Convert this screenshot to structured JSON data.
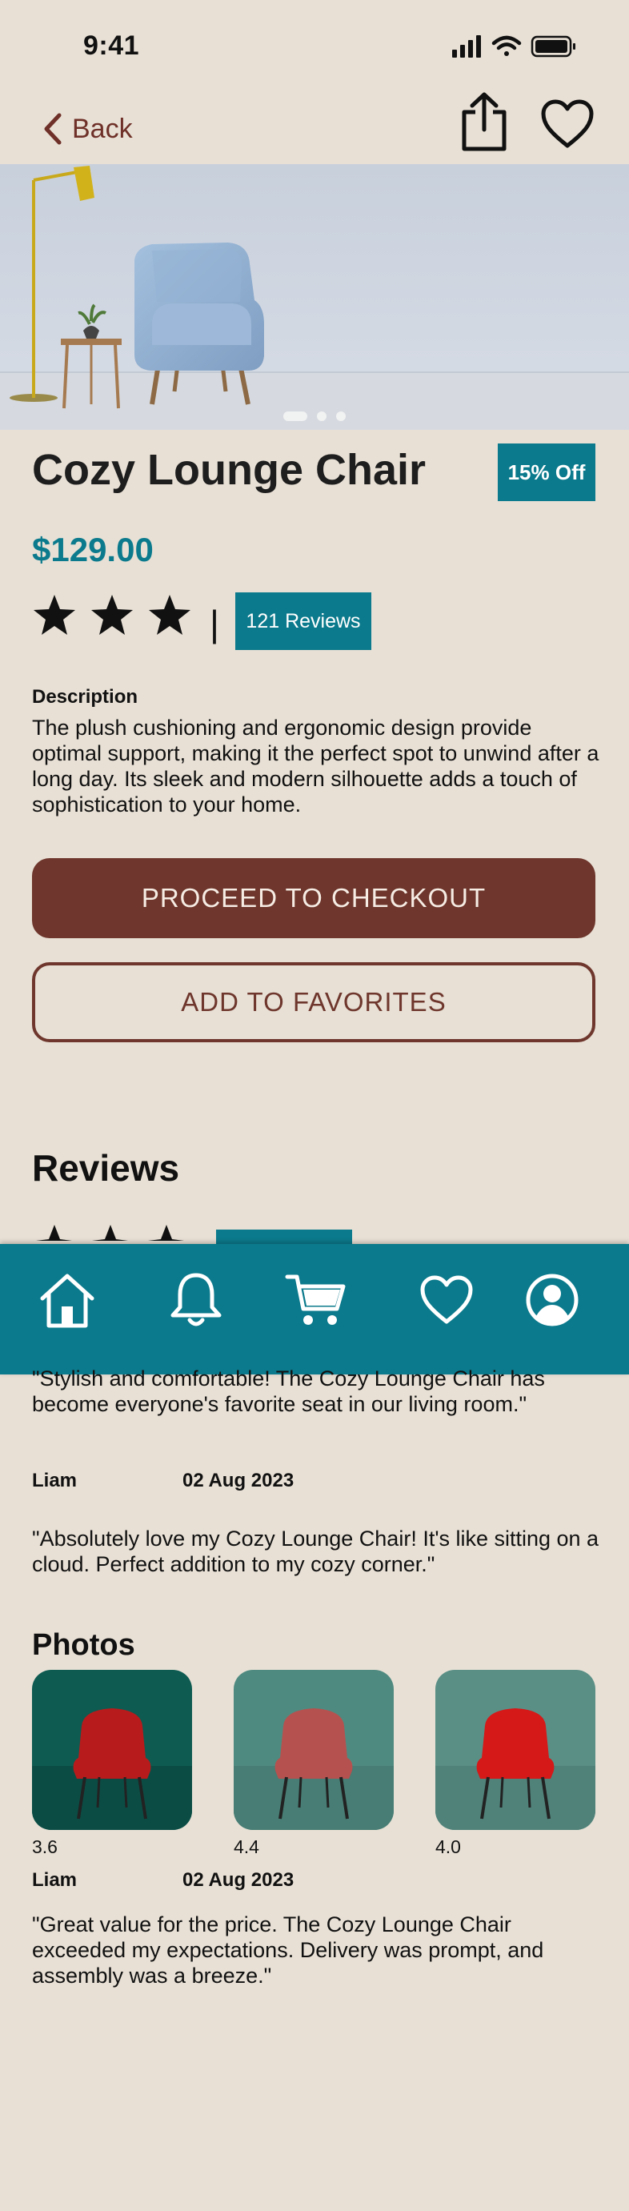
{
  "status": {
    "time": "9:41"
  },
  "nav": {
    "back_label": "Back"
  },
  "product": {
    "title": "Cozy Lounge Chair",
    "discount": "15% Off",
    "price": "$129.00",
    "rating_stars": 3,
    "reviews_count_label": "121 Reviews",
    "description_label": "Description",
    "description": "The plush cushioning and ergonomic design provide optimal support, making it the perfect spot to unwind after a long day. Its sleek and modern silhouette adds a touch of sophistication to your home."
  },
  "actions": {
    "checkout_label": "PROCEED TO CHECKOUT",
    "add_favorites_label": "ADD TO FAVORITES"
  },
  "reviews": {
    "heading": "Reviews",
    "items": [
      {
        "text": "\"Stylish and comfortable! The Cozy Lounge Chair has become everyone's favorite seat in our living room.\"",
        "name": "Liam",
        "date": "02 Aug 2023"
      },
      {
        "text": "\"Absolutely love my Cozy Lounge Chair! It's like sitting on a cloud. Perfect addition to my cozy corner.\"",
        "name": "Liam",
        "date": "02 Aug 2023"
      },
      {
        "text": " \"Great value for the price. The Cozy Lounge Chair exceeded my expectations. Delivery was prompt, and assembly was a breeze.\""
      }
    ]
  },
  "photos": {
    "heading": "Photos",
    "items": [
      {
        "rating": "3.6",
        "bg": "#0e5b52",
        "chair": "#b81b1b"
      },
      {
        "rating": "4.4",
        "bg": "#4f8a80",
        "chair": "#b5524f"
      },
      {
        "rating": "4.0",
        "bg": "#5a8f86",
        "chair": "#d51818"
      }
    ]
  },
  "tabbar": {
    "items": [
      "home-icon",
      "bell-icon",
      "cart-icon",
      "heart-icon",
      "profile-icon"
    ]
  },
  "colors": {
    "background": "#e8e0d5",
    "accent": "#0b7a8c",
    "brand_brown": "#6e362c"
  }
}
